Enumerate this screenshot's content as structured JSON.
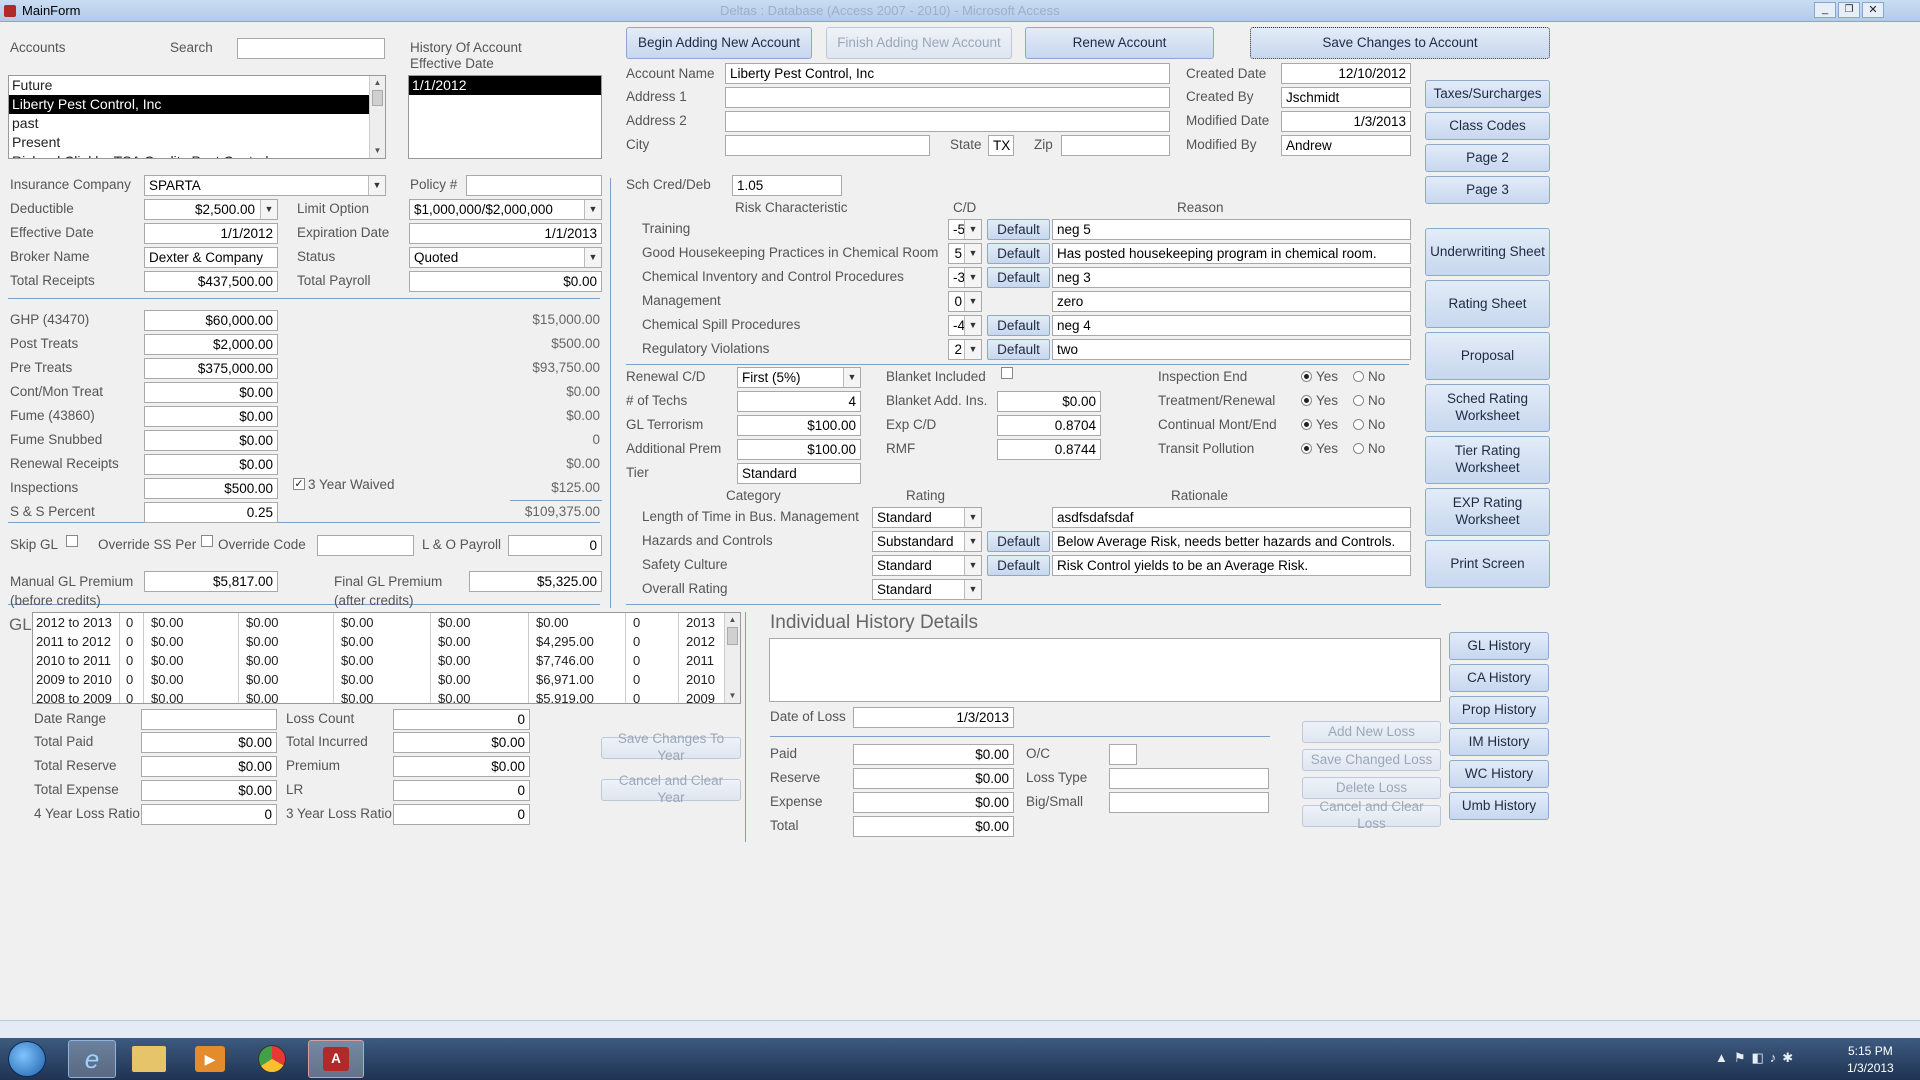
{
  "window": {
    "title": "MainForm",
    "app_title": "Deltas : Database (Access 2007 - 2010) - Microsoft Access"
  },
  "accounts": {
    "label": "Accounts",
    "search_label": "Search",
    "search_value": "",
    "items": [
      "Future",
      "Liberty Pest Control, Inc",
      "past",
      "Present",
      "Richard Clinkl... TSA Quality Pest Control"
    ],
    "selected": 1
  },
  "history": {
    "label1": "History Of Account",
    "label2": "Effective Date",
    "items": [
      "1/1/2012"
    ]
  },
  "top_buttons": {
    "begin": "Begin Adding New Account",
    "finish": "Finish Adding New Account",
    "renew": "Renew Account",
    "save": "Save Changes to Account"
  },
  "address": {
    "account_name_label": "Account Name",
    "account_name": "Liberty Pest Control, Inc",
    "address1_label": "Address 1",
    "address1": "",
    "address2_label": "Address 2",
    "address2": "",
    "city_label": "City",
    "city": "",
    "state_label": "State",
    "state": "TX",
    "zip_label": "Zip",
    "zip": ""
  },
  "meta": {
    "created_date_label": "Created Date",
    "created_date": "12/10/2012",
    "created_by_label": "Created By",
    "created_by": "Jschmidt",
    "modified_date_label": "Modified Date",
    "modified_date": "1/3/2013",
    "modified_by_label": "Modified By",
    "modified_by": "Andrew"
  },
  "side_buttons": [
    "Taxes/Surcharges",
    "Class Codes",
    "Page 2",
    "Page 3",
    "Underwriting Sheet",
    "Rating Sheet",
    "Proposal",
    "Sched Rating Worksheet",
    "Tier Rating Worksheet",
    "EXP Rating Worksheet",
    "Print Screen"
  ],
  "policy": {
    "ins_co_label": "Insurance Company",
    "ins_co": "SPARTA",
    "policy_label": "Policy #",
    "policy": "",
    "deductible_label": "Deductible",
    "deductible": "$2,500.00",
    "limit_label": "Limit Option",
    "limit": "$1,000,000/$2,000,000",
    "eff_label": "Effective Date",
    "eff": "1/1/2012",
    "exp_label": "Expiration Date",
    "exp": "1/1/2013",
    "broker_label": "Broker Name",
    "broker": "Dexter & Company",
    "status_label": "Status",
    "status": "Quoted",
    "receipts_label": "Total Receipts",
    "receipts": "$437,500.00",
    "payroll_label": "Total Payroll",
    "payroll": "$0.00"
  },
  "receipts": [
    {
      "label": "GHP (43470)",
      "value": "$60,000.00",
      "calc": "$15,000.00"
    },
    {
      "label": "Post Treats",
      "value": "$2,000.00",
      "calc": "$500.00"
    },
    {
      "label": "Pre Treats",
      "value": "$375,000.00",
      "calc": "$93,750.00"
    },
    {
      "label": "Cont/Mon Treat",
      "value": "$0.00",
      "calc": "$0.00"
    },
    {
      "label": "Fume (43860)",
      "value": "$0.00",
      "calc": "$0.00"
    },
    {
      "label": "Fume Snubbed",
      "value": "$0.00",
      "calc": "0"
    },
    {
      "label": "Renewal Receipts",
      "value": "$0.00",
      "calc": "$0.00"
    },
    {
      "label": "Inspections",
      "value": "$500.00",
      "calc": "$125.00"
    },
    {
      "label": "S & S Percent",
      "value": "0.25",
      "calc": "$109,375.00"
    }
  ],
  "waived_label": "3 Year Waived",
  "flags": {
    "skip_gl": "Skip GL",
    "override_ss": "Override SS Per",
    "override_code": "Override Code",
    "lo_payroll_label": "L & O Payroll",
    "lo_payroll": "0"
  },
  "premium": {
    "manual_label1": "Manual GL Premium",
    "manual_label2": "(before credits)",
    "manual": "$5,817.00",
    "final_label1": "Final GL Premium",
    "final_label2": "(after credits)",
    "final": "$5,325.00"
  },
  "gl_history": {
    "label": "GL",
    "rows": [
      [
        "2012 to 2013",
        "0",
        "$0.00",
        "$0.00",
        "$0.00",
        "$0.00",
        "$0.00",
        "0",
        "2013"
      ],
      [
        "2011 to 2012",
        "0",
        "$0.00",
        "$0.00",
        "$0.00",
        "$0.00",
        "$4,295.00",
        "0",
        "2012"
      ],
      [
        "2010 to 2011",
        "0",
        "$0.00",
        "$0.00",
        "$0.00",
        "$0.00",
        "$7,746.00",
        "0",
        "2011"
      ],
      [
        "2009 to 2010",
        "0",
        "$0.00",
        "$0.00",
        "$0.00",
        "$0.00",
        "$6,971.00",
        "0",
        "2010"
      ],
      [
        "2008 to 2009",
        "0",
        "$0.00",
        "$0.00",
        "$0.00",
        "$0.00",
        "$5,919.00",
        "0",
        "2009"
      ]
    ]
  },
  "loss_totals": {
    "date_range_label": "Date Range",
    "date_range": "",
    "loss_count_label": "Loss Count",
    "loss_count": "0",
    "total_paid_label": "Total Paid",
    "total_paid": "$0.00",
    "total_incurred_label": "Total Incurred",
    "total_incurred": "$0.00",
    "total_reserve_label": "Total Reserve",
    "total_reserve": "$0.00",
    "premium_label": "Premium",
    "premium": "$0.00",
    "total_expense_label": "Total Expense",
    "total_expense": "$0.00",
    "lr_label": "LR",
    "lr": "0",
    "ratio4_label": "4 Year Loss Ratio",
    "ratio4": "0",
    "ratio3_label": "3 Year Loss Ratio",
    "ratio3": "0",
    "save_year": "Save Changes To Year",
    "cancel_year": "Cancel and Clear Year"
  },
  "sched": {
    "label": "Sch Cred/Deb",
    "value": "1.05",
    "hdr_risk": "Risk Characteristic",
    "hdr_cd": "C/D",
    "hdr_reason": "Reason",
    "default_label": "Default",
    "rows": [
      {
        "name": "Training",
        "cd": "-5",
        "reason": "neg 5",
        "def": true
      },
      {
        "name": "Good Housekeeping Practices in Chemical Room",
        "cd": "5",
        "reason": "Has posted housekeeping program in chemical room.",
        "def": true
      },
      {
        "name": "Chemical Inventory and Control Procedures",
        "cd": "-3",
        "reason": "neg 3",
        "def": true
      },
      {
        "name": "Management",
        "cd": "0",
        "reason": "zero",
        "def": false
      },
      {
        "name": "Chemical Spill Procedures",
        "cd": "-4",
        "reason": "neg 4",
        "def": true
      },
      {
        "name": "Regulatory Violations",
        "cd": "2",
        "reason": "two",
        "def": true
      }
    ]
  },
  "renewal": {
    "renewal_cd_label": "Renewal C/D",
    "renewal_cd": "First (5%)",
    "techs_label": "# of Techs",
    "techs": "4",
    "terrorism_label": "GL Terrorism",
    "terrorism": "$100.00",
    "addprem_label": "Additional Prem",
    "addprem": "$100.00",
    "tier_label": "Tier",
    "tier": "Standard",
    "blanket_label": "Blanket Included",
    "blanket_add_label": "Blanket Add. Ins.",
    "blanket_add": "$0.00",
    "expcd_label": "Exp C/D",
    "expcd": "0.8704",
    "rmf_label": "RMF",
    "rmf": "0.8744",
    "yes": "Yes",
    "no": "No",
    "radios": [
      "Inspection End",
      "Treatment/Renewal",
      "Continual Mont/End",
      "Transit Pollution"
    ]
  },
  "tier_rating": {
    "hdr_cat": "Category",
    "hdr_rating": "Rating",
    "hdr_rat": "Rationale",
    "rows": [
      {
        "name": "Length of Time in Bus. Management",
        "rating": "Standard",
        "rationale": "asdfsdafsdaf",
        "def": false
      },
      {
        "name": "Hazards and Controls",
        "rating": "Substandard",
        "rationale": "Below Average Risk, needs better hazards and Controls.",
        "def": true
      },
      {
        "name": "Safety Culture",
        "rating": "Standard",
        "rationale": "Risk Control yields to be an Average Risk.",
        "def": true
      },
      {
        "name": "Overall Rating",
        "rating": "Standard",
        "rationale": "",
        "def": false
      }
    ]
  },
  "individual": {
    "title": "Individual History Details",
    "date_loss_label": "Date of Loss",
    "date_loss": "1/3/2013",
    "paid_label": "Paid",
    "paid": "$0.00",
    "reserve_label": "Reserve",
    "reserve": "$0.00",
    "expense_label": "Expense",
    "expense": "$0.00",
    "total_label": "Total",
    "total": "$0.00",
    "oc_label": "O/C",
    "loss_type_label": "Loss Type",
    "big_small_label": "Big/Small",
    "add_loss": "Add New Loss",
    "save_loss": "Save Changed Loss",
    "delete_loss": "Delete  Loss",
    "cancel_loss": "Cancel and Clear Loss"
  },
  "history_buttons": [
    "GL History",
    "CA History",
    "Prop History",
    "IM History",
    "WC History",
    "Umb History"
  ],
  "taskbar": {
    "time": "5:15 PM",
    "date": "1/3/2013"
  }
}
